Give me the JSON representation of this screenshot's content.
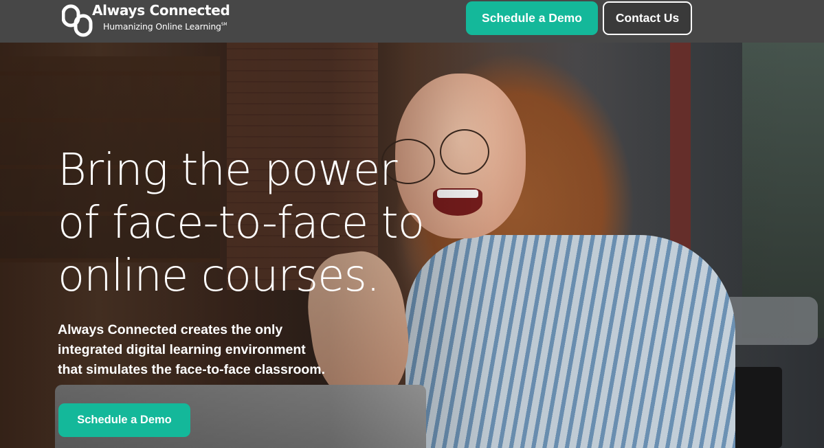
{
  "header": {
    "logo_title": "Always Connected",
    "logo_tagline": "Humanizing Online Learning",
    "logo_tagline_mark": "SM",
    "schedule_demo_label": "Schedule a Demo",
    "contact_label": "Contact Us"
  },
  "hero": {
    "headline_lines": [
      "Bring the power",
      "of face-to-face to",
      "online courses."
    ],
    "subtext_lines": [
      "Always Connected creates the only",
      "integrated digital learning environment",
      "that simulates the face-to-face classroom."
    ],
    "cta_label": "Schedule a Demo"
  },
  "colors": {
    "header_bg": "#474747",
    "accent": "#14b89a",
    "text": "#ffffff"
  },
  "icons": [
    "logo-icon"
  ]
}
